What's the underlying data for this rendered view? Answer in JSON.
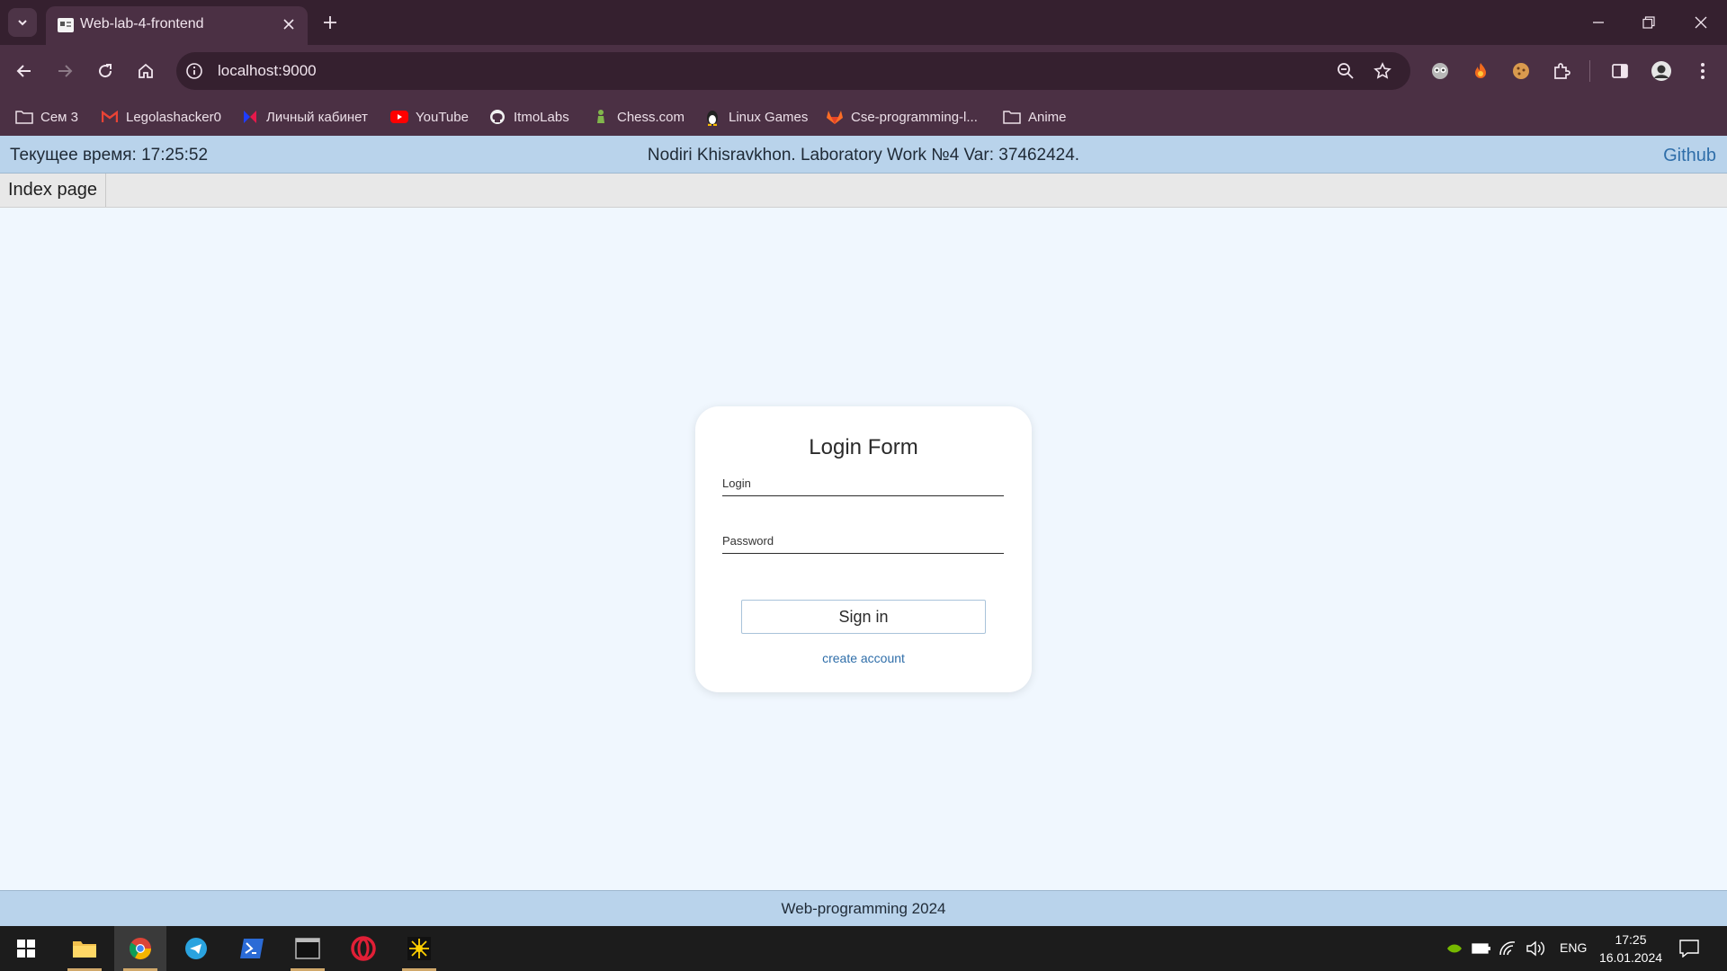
{
  "browser": {
    "tab_title": "Web-lab-4-frontend",
    "url": "localhost:9000",
    "bookmarks": [
      {
        "label": "Сем 3",
        "icon": "folder-icon"
      },
      {
        "label": "Legolashacker0",
        "icon": "gmail-icon"
      },
      {
        "label": "Личный кабинет",
        "icon": "itmo-icon"
      },
      {
        "label": "YouTube",
        "icon": "youtube-icon"
      },
      {
        "label": "ItmoLabs",
        "icon": "github-icon"
      },
      {
        "label": "Chess.com",
        "icon": "chess-pawn-icon"
      },
      {
        "label": "Linux Games",
        "icon": "linux-icon"
      },
      {
        "label": "Cse-programming-l...",
        "icon": "gitlab-icon"
      },
      {
        "label": "Anime",
        "icon": "folder-icon"
      }
    ]
  },
  "header": {
    "time_text": "Текущее время: 17:25:52",
    "title": "Nodiri Khisravkhon. Laboratory Work №4 Var: 37462424.",
    "github_link": "Github"
  },
  "nav": {
    "index_page": "Index page"
  },
  "login": {
    "title": "Login Form",
    "login_placeholder": "Login",
    "password_placeholder": "Password",
    "signin_label": "Sign in",
    "create_account": "create account"
  },
  "footer": {
    "text": "Web-programming 2024"
  },
  "taskbar": {
    "lang": "ENG",
    "time": "17:25",
    "date": "16.01.2024"
  },
  "colors": {
    "chrome_dark": "#35202f",
    "chrome": "#4b3044",
    "page_bg": "#f0f7fe",
    "header_bg": "#b9d3eb",
    "link": "#2f6ea9"
  }
}
